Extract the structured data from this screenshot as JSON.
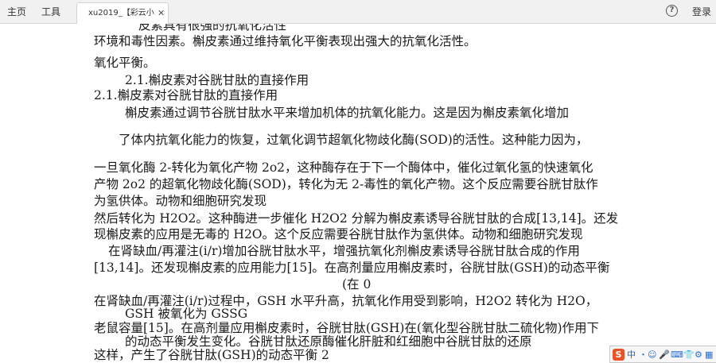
{
  "toolbar": {
    "home_label": "主页",
    "tools_label": "工具",
    "doc_tab_title": "xu2019_【彩云小...",
    "close_glyph": "✕",
    "help_glyph": "?",
    "login_label": "登录"
  },
  "document": {
    "lines": [
      "皮素具有很强的抗氧化活性",
      "环境和毒性因素。槲皮素通过维持氧化平衡表现出强大的抗氧化活性。",
      "氧化平衡。",
      "2.1.槲皮素对谷胱甘肽的直接作用",
      "2.1.槲皮素对谷胱甘肽的直接作用",
      "槲皮素通过调节谷胱甘肽水平来增加机体的抗氧化能力。这是因为槲皮素氧化增加",
      "了体内抗氧化能力的恢复，过氧化调节超氧化物歧化酶(SOD)的活性。这种能力因为，",
      "一旦氧化酶 2-转化为氧化产物 2o2，这种酶存在于下一个酶体中，催化过氧化氢的快速氧化",
      "产物 2o2 的超氧化物歧化酶(SOD)，转化为无 2-毒性的氧化产物。这个反应需要谷胱甘肽作",
      "为氢供体。动物和细胞研究发现",
      "然后转化为 H2O2。这种酶进一步催化 H2O2 分解为槲皮素诱导谷胱甘肽的合成[13,14]。还发",
      "现槲皮素的应用是无毒的 H2O。这个反应需要谷胱甘肽作为氢供体。动物和细胞研究发现",
      "在肾缺血/再灌注(i/r)增加谷胱甘肽水平，增强抗氧化剂槲皮素诱导谷胱甘肽合成的作用",
      "[13,14]。还发现槲皮素的应用能力[15]。在高剂量应用槲皮素时，谷胱甘肽(GSH)的动态平衡",
      "(在 0",
      "在肾缺血/再灌注(i/r)过程中，GSH 水平升高，抗氧化作用受到影响，H2O2 转化为 H2O，",
      "GSH 被氧化为 GSSG",
      "老鼠容量[15]。在高剂量应用槲皮素时，谷胱甘肽(GSH)在(氧化型谷胱甘肽二硫化物)作用下",
      "的动态平衡发生变化。谷胱甘肽还原酶催化肝脏和红细胞中谷胱甘肽的还原",
      "这样，产生了谷胱甘肽(GSH)的动态平衡 2"
    ]
  },
  "ime": {
    "logo_glyph": "S",
    "lang_label": "中",
    "buttons": [
      "・",
      "☺",
      "🎤",
      "⌨",
      "👕",
      "⚙",
      "▦"
    ]
  },
  "colors": {
    "toolbar_bg": "#f1f1f1",
    "ime_logo": "#e8542a",
    "ime_accent": "#2a6fd6"
  }
}
